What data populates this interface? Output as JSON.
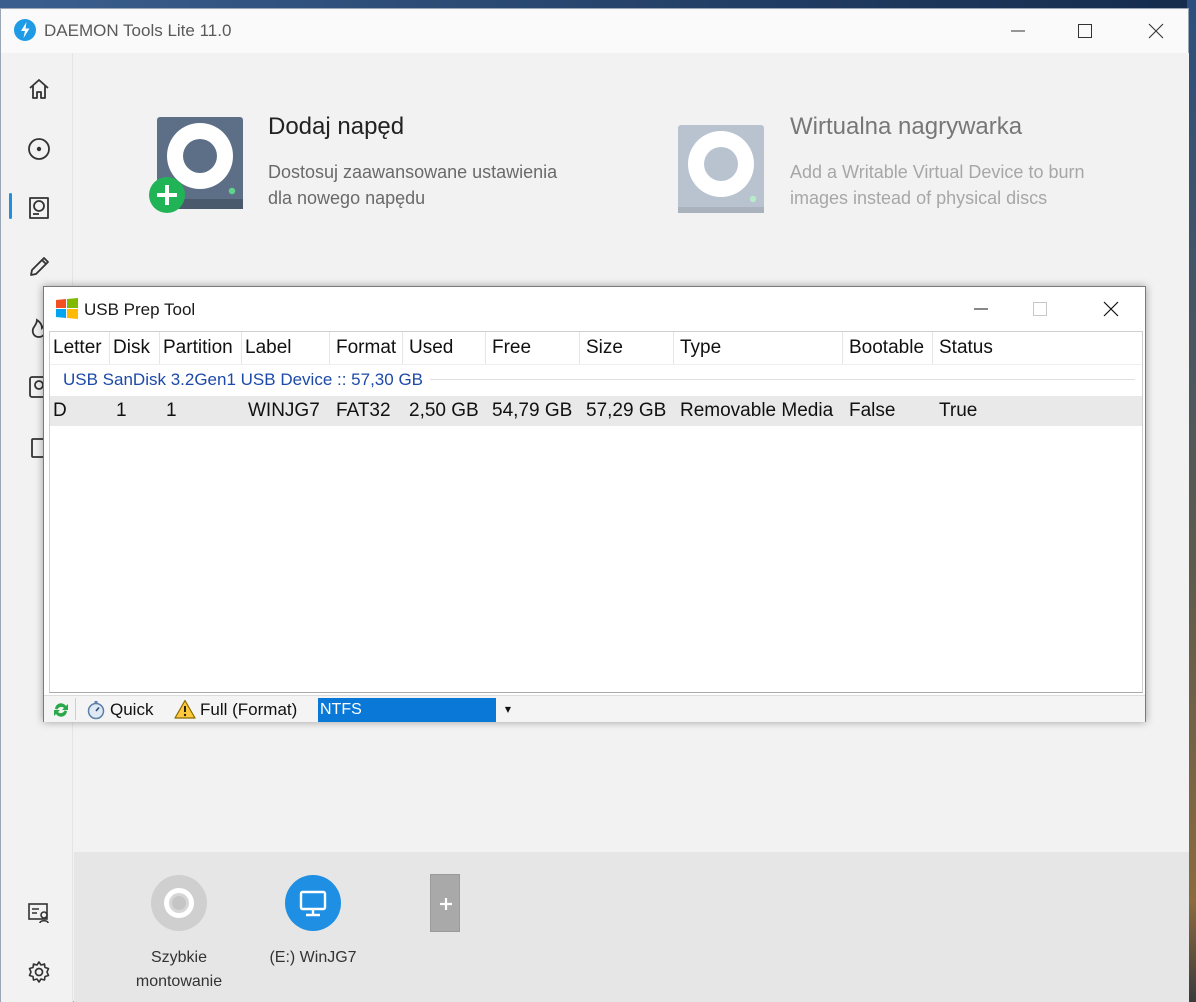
{
  "app": {
    "title": "DAEMON Tools Lite 11.0",
    "accent_color": "#1f9be6",
    "window_controls": [
      "minimize-icon",
      "maximize-icon",
      "close-icon"
    ]
  },
  "sidebar": {
    "items": [
      {
        "name": "home",
        "icon": "home-icon"
      },
      {
        "name": "images",
        "icon": "disc-icon"
      },
      {
        "name": "virtual-drives",
        "icon": "drive-icon",
        "active": true
      },
      {
        "name": "burn",
        "icon": "pencil-icon"
      },
      {
        "name": "fire",
        "icon": "flame-icon"
      },
      {
        "name": "hdd",
        "icon": "hdd-icon"
      },
      {
        "name": "usb",
        "icon": "usb-icon"
      }
    ],
    "bottom_items": [
      {
        "name": "license",
        "icon": "license-icon"
      },
      {
        "name": "settings",
        "icon": "gear-icon"
      }
    ]
  },
  "tiles": [
    {
      "title": "Dodaj napęd",
      "description": [
        "Dostosuj zaawansowane ustawienia",
        "dla nowego napędu"
      ],
      "icon": "add-drive-icon"
    },
    {
      "title": "Wirtualna nagrywarka",
      "description": [
        "Add a Writable Virtual Device to burn",
        "images instead of physical discs"
      ],
      "icon": "virtual-burner-icon",
      "disabled": true
    }
  ],
  "devices": [
    {
      "label": [
        "Szybkie",
        "montowanie"
      ],
      "icon": "quick-mount-icon"
    },
    {
      "label": [
        "(E:) WinJG7"
      ],
      "icon": "monitor-icon"
    },
    {
      "label": [],
      "icon": "plus-icon"
    }
  ],
  "usb_tool": {
    "title": "USB Prep Tool",
    "columns": [
      "Letter",
      "Disk",
      "Partition",
      "Label",
      "Format",
      "Used",
      "Free",
      "Size",
      "Type",
      "Bootable",
      "Status"
    ],
    "group": "USB  SanDisk 3.2Gen1 USB Device :: 57,30 GB",
    "rows": [
      [
        "D",
        "1",
        "1",
        "WINJG7",
        "FAT32",
        "2,50 GB",
        "54,79 GB",
        "57,29 GB",
        "Removable Media",
        "False",
        "True"
      ]
    ],
    "footer": {
      "quick_label": "Quick",
      "full_label": "Full (Format)",
      "format_value": "NTFS"
    }
  }
}
